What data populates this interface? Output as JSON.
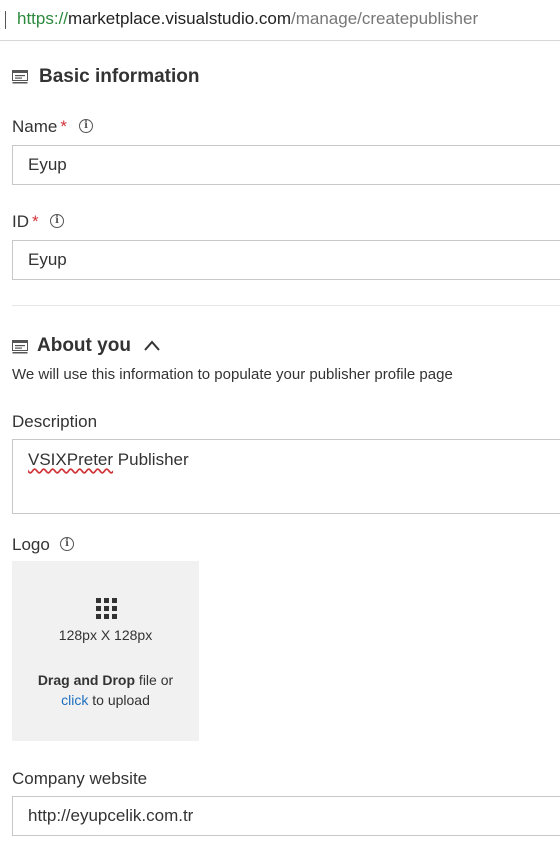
{
  "browser": {
    "url_scheme": "https://",
    "url_host": "marketplace.visualstudio.com",
    "url_path": "/manage/createpublisher"
  },
  "basic_info": {
    "title": "Basic information",
    "name_label": "Name",
    "name_value": "Eyup",
    "id_label": "ID",
    "id_value": "Eyup",
    "required_mark": "*"
  },
  "about": {
    "title": "About you",
    "description_text": "We will use this information to populate your publisher profile page",
    "description_label": "Description",
    "description_value_word1": "VSIXPreter",
    "description_value_word2": " Publisher",
    "logo_label": "Logo",
    "logo_size": "128px X 128px",
    "drag_drop_bold": "Drag and Drop",
    "drag_drop_rest": " file or",
    "click_link": "click",
    "upload_text": " to upload",
    "website_label": "Company website",
    "website_value": "http://eyupcelik.com.tr"
  },
  "icons": {
    "section": "form-section-icon",
    "info": "info-icon",
    "collapse": "chevron-up-icon",
    "logo": "grid-icon"
  }
}
